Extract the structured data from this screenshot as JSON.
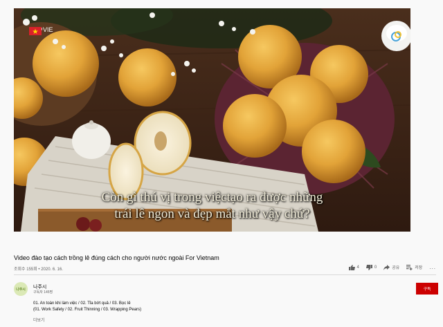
{
  "player": {
    "channel_tag": "VIE",
    "subtitle_line1": "Còn gì thú vị trong việctạo ra được những",
    "subtitle_line2": "trái lê ngon và đẹp mắt như vậy chứ?"
  },
  "video": {
    "title": "Video đào tạo cách trồng lê đúng cách cho người nước ngoài For Vietnam",
    "views_date": "조회수 155회 • 2020. 6. 16.",
    "likes": "4",
    "dislikes": "0",
    "share_label": "공유",
    "save_label": "저장",
    "more_label": "..."
  },
  "channel": {
    "avatar_text": "나주시",
    "name": "나주시",
    "subscribers": "구독자 145명",
    "subscribe_label": "구독"
  },
  "description": {
    "line1": "01. An toàn khi làm việc / 02. Tỉa bớt quả / 03. Bọc lê",
    "line2": "(01. Work Safety / 02. Fruit Thinning / 03. Wrapping Pears)",
    "show_more": "더보기"
  },
  "colors": {
    "subscribe": "#cc0000",
    "background": "#f9f9f9",
    "pear": "#e0a436"
  }
}
